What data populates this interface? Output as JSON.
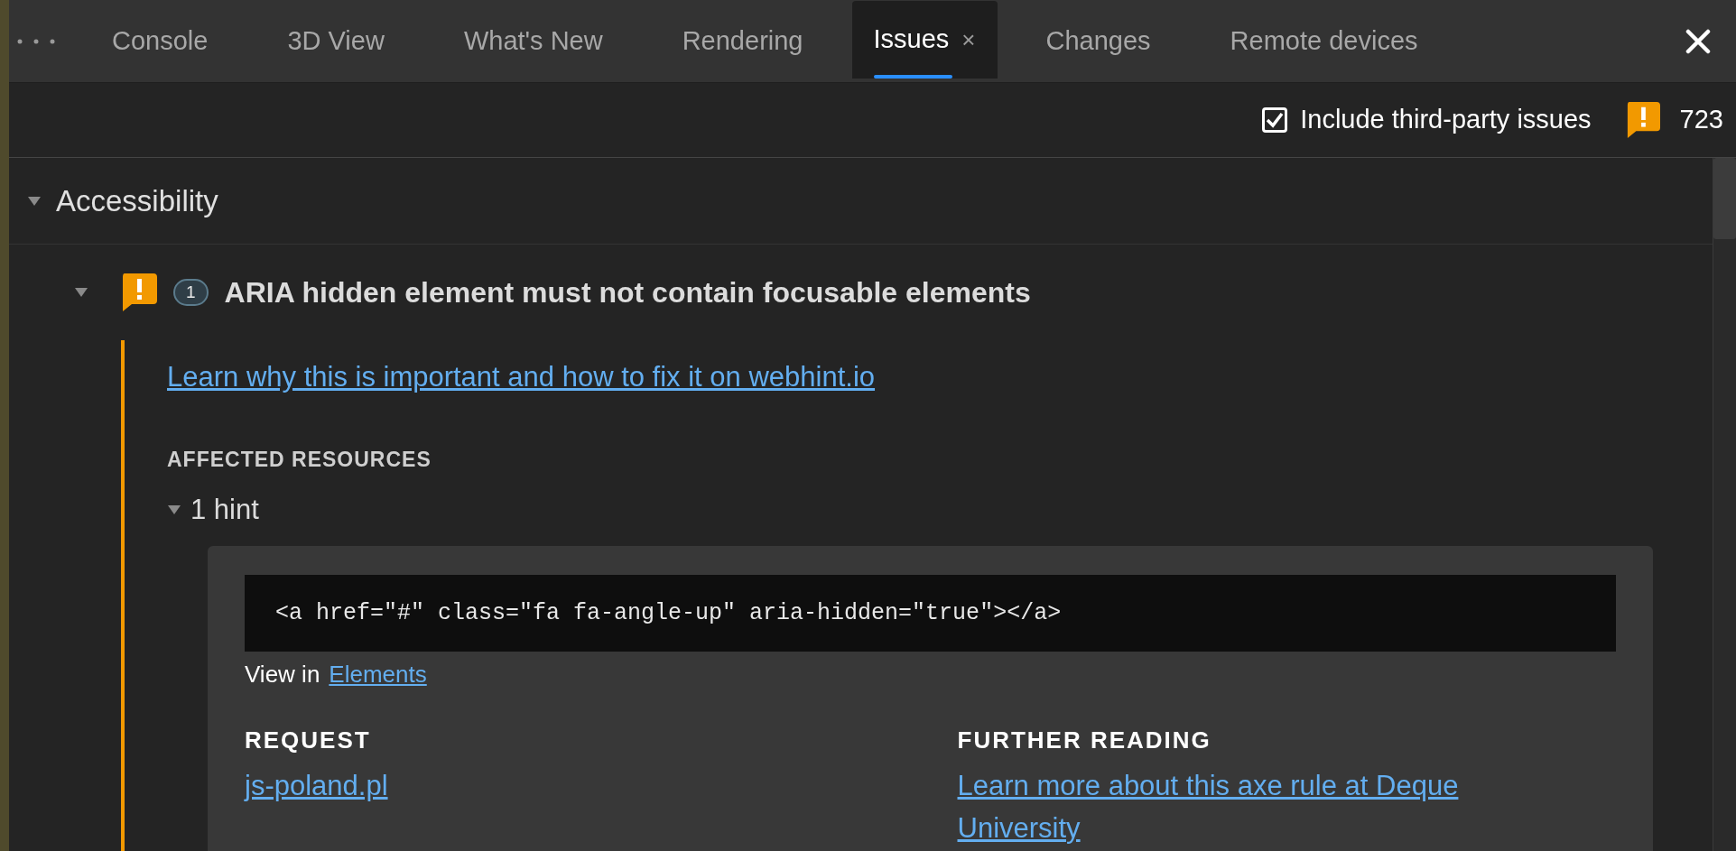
{
  "tabs": [
    {
      "label": "Console",
      "selected": false
    },
    {
      "label": "3D View",
      "selected": false
    },
    {
      "label": "What's New",
      "selected": false
    },
    {
      "label": "Rendering",
      "selected": false
    },
    {
      "label": "Issues",
      "selected": true,
      "close": "×"
    },
    {
      "label": "Changes",
      "selected": false
    },
    {
      "label": "Remote devices",
      "selected": false
    }
  ],
  "toolbar": {
    "third_party": {
      "label": "Include third-party issues",
      "checked": true
    },
    "issue_count": "723"
  },
  "category": {
    "title": "Accessibility",
    "expanded": true,
    "issue": {
      "title": "ARIA hidden element must not contain focusable elements",
      "count": "1",
      "expanded": true,
      "learn_link": "Learn why this is important and how to fix it on webhint.io",
      "affected_heading": "AFFECTED RESOURCES",
      "hints": {
        "label": "1 hint",
        "expanded": true,
        "code": "<a href=\"#\" class=\"fa fa-angle-up\" aria-hidden=\"true\"></a>",
        "view_in": "View in",
        "view_link": "Elements",
        "request_heading": "REQUEST",
        "request_link": "js-poland.pl",
        "reading_heading": "FURTHER READING",
        "reading_link": "Learn more about this axe rule at Deque University"
      }
    }
  }
}
